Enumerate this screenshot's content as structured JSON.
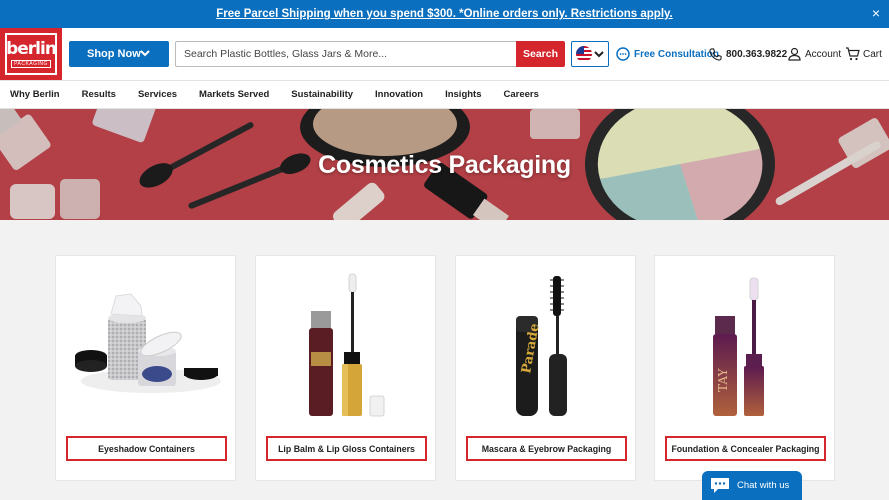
{
  "promo": {
    "text": "Free Parcel Shipping when you spend $300. *Online orders only. Restrictions apply.",
    "close_glyph": "×"
  },
  "header": {
    "logo_text": "berlin",
    "logo_subtext": "PACKAGING",
    "shop_now": "Shop Now",
    "search_placeholder": "Search Plastic Bottles, Glass Jars & More...",
    "search_button": "Search",
    "country_flag": "us-flag-icon",
    "consultation": "Free Consultation",
    "phone": "800.363.9822",
    "account": "Account",
    "cart": "Cart"
  },
  "nav": {
    "items": [
      "Why Berlin",
      "Results",
      "Services",
      "Markets Served",
      "Sustainability",
      "Innovation",
      "Insights",
      "Careers"
    ]
  },
  "hero": {
    "title": "Cosmetics Packaging"
  },
  "cards": [
    {
      "label": "Eyeshadow Containers",
      "image": "eyeshadow-containers-image"
    },
    {
      "label": "Lip Balm & Lip Gloss Containers",
      "image": "lip-gloss-image"
    },
    {
      "label": "Mascara & Eyebrow Packaging",
      "image": "mascara-image",
      "product_text": "Parade"
    },
    {
      "label": "Foundation & Concealer Packaging",
      "image": "foundation-image",
      "product_text": "TAY"
    }
  ],
  "chat": {
    "label": "Chat with us"
  },
  "colors": {
    "brand_blue": "#0a6fbf",
    "brand_red": "#d6262d",
    "hero_bg": "#c94a50"
  }
}
